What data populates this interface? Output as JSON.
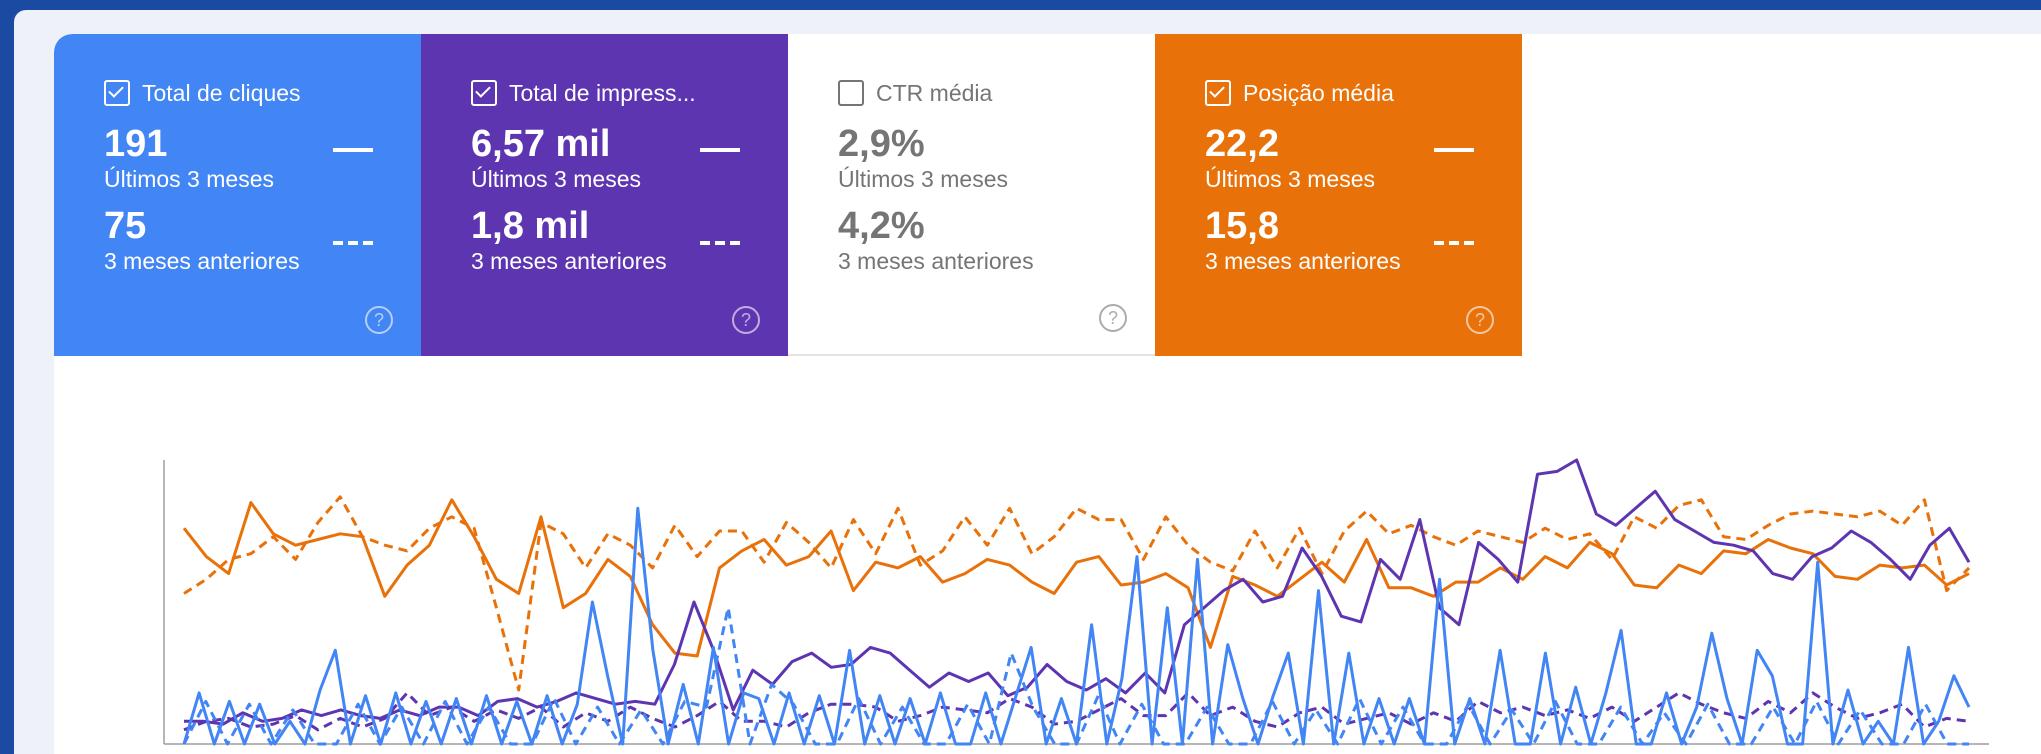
{
  "metrics": [
    {
      "title": "Total de cliques",
      "checked": true,
      "value": "191",
      "period": "Últimos 3 meses",
      "prev_value": "75",
      "prev_period": "3 meses anteriores",
      "color": "#4285f4",
      "help_icon": "help-circle-icon",
      "help_glyph": "?"
    },
    {
      "title": "Total de impress...",
      "checked": true,
      "value": "6,57 mil",
      "period": "Últimos 3 meses",
      "prev_value": "1,8 mil",
      "prev_period": "3 meses anteriores",
      "color": "#5e35b1",
      "help_icon": "help-circle-icon",
      "help_glyph": "?"
    },
    {
      "title": "CTR média",
      "checked": false,
      "value": "2,9%",
      "period": "Últimos 3 meses",
      "prev_value": "4,2%",
      "prev_period": "3 meses anteriores",
      "color": "#ffffff",
      "help_icon": "help-circle-icon",
      "help_glyph": "?"
    },
    {
      "title": "Posição média",
      "checked": true,
      "value": "22,2",
      "period": "Últimos 3 meses",
      "prev_value": "15,8",
      "prev_period": "3 meses anteriores",
      "color": "#e8710a",
      "help_icon": "help-circle-icon",
      "help_glyph": "?"
    }
  ],
  "chart_data": {
    "type": "line",
    "xlabel": "",
    "ylabel": "",
    "grid": false,
    "series": [
      {
        "metric": "Posição média",
        "period": "Últimos 3 meses",
        "style": "solid",
        "color": "#e8710a",
        "values": [
          0.76,
          0.66,
          0.6,
          0.85,
          0.74,
          0.7,
          0.72,
          0.74,
          0.73,
          0.52,
          0.63,
          0.7,
          0.86,
          0.73,
          0.58,
          0.53,
          0.8,
          0.48,
          0.53,
          0.65,
          0.59,
          0.42,
          0.32,
          0.31,
          0.62,
          0.68,
          0.72,
          0.63,
          0.66,
          0.75,
          0.54,
          0.64,
          0.62,
          0.66,
          0.57,
          0.6,
          0.65,
          0.63,
          0.57,
          0.53,
          0.64,
          0.66,
          0.56,
          0.57,
          0.6,
          0.55,
          0.34,
          0.59,
          0.56,
          0.52,
          0.58,
          0.64,
          0.57,
          0.72,
          0.55,
          0.55,
          0.52,
          0.57,
          0.57,
          0.62,
          0.58,
          0.66,
          0.62,
          0.71,
          0.67,
          0.56,
          0.55,
          0.63,
          0.6,
          0.68,
          0.67,
          0.72,
          0.69,
          0.67,
          0.59,
          0.58,
          0.63,
          0.62,
          0.63,
          0.56,
          0.6
        ]
      },
      {
        "metric": "Posição média",
        "period": "3 meses anteriores",
        "style": "dashed",
        "color": "#e8710a",
        "values": [
          0.53,
          0.58,
          0.65,
          0.67,
          0.73,
          0.65,
          0.78,
          0.87,
          0.73,
          0.7,
          0.68,
          0.76,
          0.8,
          0.76,
          0.48,
          0.19,
          0.78,
          0.74,
          0.62,
          0.74,
          0.7,
          0.62,
          0.77,
          0.66,
          0.75,
          0.75,
          0.64,
          0.78,
          0.71,
          0.62,
          0.79,
          0.67,
          0.83,
          0.63,
          0.68,
          0.8,
          0.7,
          0.83,
          0.67,
          0.73,
          0.83,
          0.79,
          0.79,
          0.65,
          0.8,
          0.7,
          0.64,
          0.61,
          0.75,
          0.62,
          0.76,
          0.6,
          0.75,
          0.82,
          0.74,
          0.77,
          0.73,
          0.7,
          0.75,
          0.73,
          0.71,
          0.76,
          0.72,
          0.74,
          0.65,
          0.8,
          0.76,
          0.84,
          0.86,
          0.73,
          0.72,
          0.77,
          0.81,
          0.82,
          0.81,
          0.8,
          0.82,
          0.77,
          0.86,
          0.54,
          0.62
        ]
      },
      {
        "metric": "Total de impressões",
        "period": "Últimos 3 meses",
        "style": "solid",
        "color": "#5e35b1",
        "values": [
          0.08,
          0.08,
          0.07,
          0.11,
          0.08,
          0.09,
          0.12,
          0.1,
          0.12,
          0.1,
          0.09,
          0.12,
          0.1,
          0.13,
          0.13,
          0.1,
          0.15,
          0.16,
          0.13,
          0.15,
          0.18,
          0.16,
          0.14,
          0.15,
          0.14,
          0.28,
          0.5,
          0.33,
          0.12,
          0.26,
          0.21,
          0.29,
          0.32,
          0.27,
          0.28,
          0.34,
          0.32,
          0.26,
          0.2,
          0.25,
          0.22,
          0.25,
          0.17,
          0.2,
          0.28,
          0.22,
          0.19,
          0.23,
          0.18,
          0.25,
          0.18,
          0.42,
          0.48,
          0.54,
          0.58,
          0.5,
          0.52,
          0.69,
          0.59,
          0.45,
          0.43,
          0.65,
          0.58,
          0.79,
          0.48,
          0.42,
          0.71,
          0.65,
          0.57,
          0.95,
          0.96,
          1.0,
          0.81,
          0.77,
          0.83,
          0.89,
          0.79,
          0.75,
          0.71,
          0.7,
          0.68,
          0.6,
          0.58,
          0.66,
          0.69,
          0.75,
          0.71,
          0.65,
          0.58,
          0.7,
          0.76,
          0.64
        ]
      },
      {
        "metric": "Total de impressões",
        "period": "3 meses anteriores",
        "style": "dashed",
        "color": "#5e35b1",
        "values": [
          0.05,
          0.08,
          0.09,
          0.06,
          0.07,
          0.1,
          0.05,
          0.09,
          0.06,
          0.09,
          0.18,
          0.1,
          0.13,
          0.08,
          0.12,
          0.09,
          0.13,
          0.06,
          0.11,
          0.08,
          0.13,
          0.09,
          0.06,
          0.1,
          0.15,
          0.08,
          0.08,
          0.06,
          0.11,
          0.14,
          0.14,
          0.13,
          0.08,
          0.1,
          0.13,
          0.12,
          0.11,
          0.16,
          0.13,
          0.07,
          0.08,
          0.12,
          0.16,
          0.1,
          0.1,
          0.18,
          0.1,
          0.13,
          0.08,
          0.06,
          0.11,
          0.13,
          0.07,
          0.09,
          0.11,
          0.07,
          0.11,
          0.08,
          0.15,
          0.11,
          0.13,
          0.1,
          0.12,
          0.09,
          0.13,
          0.08,
          0.13,
          0.18,
          0.14,
          0.11,
          0.09,
          0.15,
          0.11,
          0.18,
          0.13,
          0.09,
          0.11,
          0.14,
          0.06,
          0.09,
          0.08
        ]
      },
      {
        "metric": "Total de cliques",
        "period": "Últimos 3 meses",
        "style": "solid",
        "color": "#4285f4",
        "values": [
          0.0,
          0.18,
          0.0,
          0.15,
          0.0,
          0.14,
          0.0,
          0.08,
          0.0,
          0.19,
          0.33,
          0.0,
          0.17,
          0.0,
          0.18,
          0.0,
          0.15,
          0.0,
          0.16,
          0.0,
          0.17,
          0.0,
          0.15,
          0.0,
          0.17,
          0.0,
          0.14,
          0.5,
          0.24,
          0.0,
          0.83,
          0.33,
          0.0,
          0.21,
          0.0,
          0.34,
          0.0,
          0.18,
          0.16,
          0.0,
          0.18,
          0.0,
          0.17,
          0.0,
          0.33,
          0.0,
          0.17,
          0.0,
          0.16,
          0.0,
          0.18,
          0.0,
          0.0,
          0.18,
          0.0,
          0.17,
          0.34,
          0.0,
          0.16,
          0.0,
          0.42,
          0.0,
          0.23,
          0.66,
          0.0,
          0.48,
          0.0,
          0.65,
          0.0,
          0.35,
          0.16,
          0.0,
          0.17,
          0.32,
          0.0,
          0.54,
          0.0,
          0.32,
          0.0,
          0.16,
          0.0,
          0.16,
          0.0,
          0.58,
          0.0,
          0.16,
          0.0,
          0.33,
          0.0,
          0.0,
          0.32,
          0.0,
          0.2,
          0.0,
          0.18,
          0.4,
          0.0,
          0.0,
          0.18,
          0.0,
          0.13,
          0.39,
          0.16,
          0.0,
          0.33,
          0.24,
          0.0,
          0.0,
          0.64,
          0.0,
          0.19,
          0.0,
          0.08,
          0.0,
          0.34,
          0.0,
          0.08,
          0.24,
          0.13
        ]
      },
      {
        "metric": "Total de cliques",
        "period": "3 meses anteriores",
        "style": "dashed",
        "color": "#4285f4",
        "values": [
          0.0,
          0.15,
          0.0,
          0.14,
          0.0,
          0.12,
          0.0,
          0.0,
          0.14,
          0.0,
          0.13,
          0.0,
          0.15,
          0.0,
          0.13,
          0.0,
          0.0,
          0.16,
          0.0,
          0.13,
          0.0,
          0.12,
          0.0,
          0.15,
          0.13,
          0.48,
          0.0,
          0.21,
          0.14,
          0.0,
          0.0,
          0.16,
          0.0,
          0.13,
          0.0,
          0.0,
          0.14,
          0.0,
          0.32,
          0.13,
          0.0,
          0.0,
          0.17,
          0.0,
          0.14,
          0.0,
          0.0,
          0.13,
          0.0,
          0.0,
          0.15,
          0.0,
          0.12,
          0.0,
          0.16,
          0.0,
          0.13,
          0.0,
          0.0,
          0.14,
          0.0,
          0.12,
          0.0,
          0.15,
          0.0,
          0.0,
          0.13,
          0.0,
          0.11,
          0.0,
          0.14,
          0.0,
          0.0,
          0.13,
          0.0,
          0.15,
          0.0,
          0.12,
          0.0,
          0.0,
          0.14,
          0.0,
          0.0
        ]
      }
    ]
  }
}
